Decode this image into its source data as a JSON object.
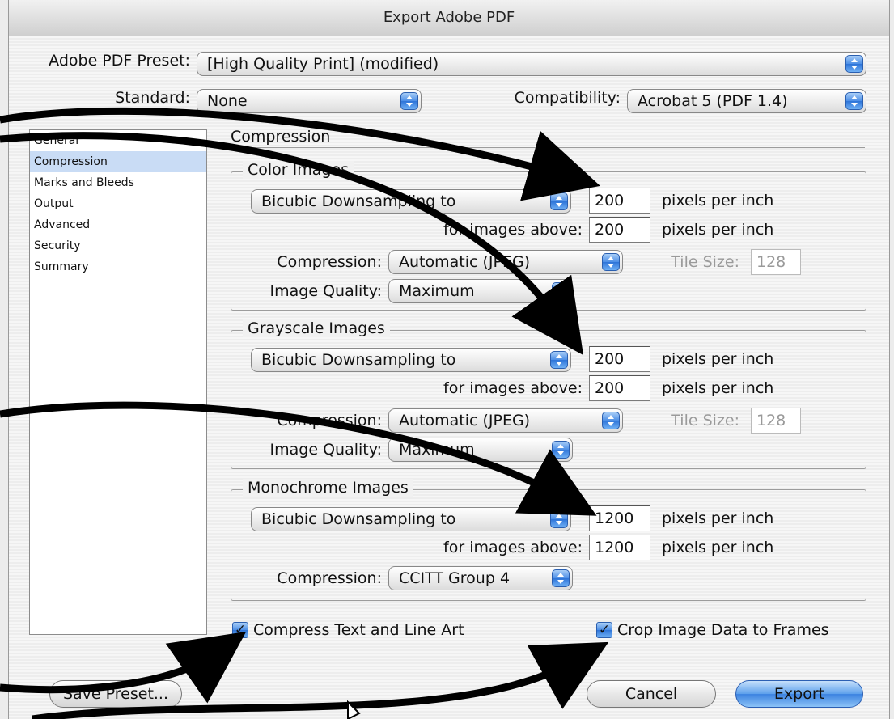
{
  "window": {
    "title": "Export Adobe PDF"
  },
  "preset": {
    "label": "Adobe PDF Preset:",
    "value": "[High Quality Print] (modified)"
  },
  "standard": {
    "label": "Standard:",
    "value": "None"
  },
  "compatibility": {
    "label": "Compatibility:",
    "value": "Acrobat 5 (PDF 1.4)"
  },
  "sidebar": {
    "items": [
      {
        "label": "General"
      },
      {
        "label": "Compression"
      },
      {
        "label": "Marks and Bleeds"
      },
      {
        "label": "Output"
      },
      {
        "label": "Advanced"
      },
      {
        "label": "Security"
      },
      {
        "label": "Summary"
      }
    ],
    "selected": "Compression"
  },
  "panel": {
    "title": "Compression"
  },
  "color_images": {
    "title": "Color Images",
    "downsampling": "Bicubic Downsampling to",
    "ppi": "200",
    "ppi_unit": "pixels per inch",
    "above_label": "for images above:",
    "above": "200",
    "above_unit": "pixels per inch",
    "compression_label": "Compression:",
    "compression": "Automatic (JPEG)",
    "tile_label": "Tile Size:",
    "tile": "128",
    "quality_label": "Image Quality:",
    "quality": "Maximum"
  },
  "grayscale_images": {
    "title": "Grayscale Images",
    "downsampling": "Bicubic Downsampling to",
    "ppi": "200",
    "ppi_unit": "pixels per inch",
    "above_label": "for images above:",
    "above": "200",
    "above_unit": "pixels per inch",
    "compression_label": "Compression:",
    "compression": "Automatic (JPEG)",
    "tile_label": "Tile Size:",
    "tile": "128",
    "quality_label": "Image Quality:",
    "quality": "Maximum"
  },
  "monochrome_images": {
    "title": "Monochrome Images",
    "downsampling": "Bicubic Downsampling to",
    "ppi": "1200",
    "ppi_unit": "pixels per inch",
    "above_label": "for images above:",
    "above": "1200",
    "above_unit": "pixels per inch",
    "compression_label": "Compression:",
    "compression": "CCITT Group 4"
  },
  "options": {
    "compress_text": {
      "label": "Compress Text and Line Art",
      "checked": true
    },
    "crop_image": {
      "label": "Crop Image Data to Frames",
      "checked": true
    }
  },
  "buttons": {
    "save_preset": "Save Preset...",
    "cancel": "Cancel",
    "export": "Export"
  },
  "colors": {
    "accent": "#3b82e0",
    "selection": "#c9dcf5",
    "annotation": "#000000"
  }
}
